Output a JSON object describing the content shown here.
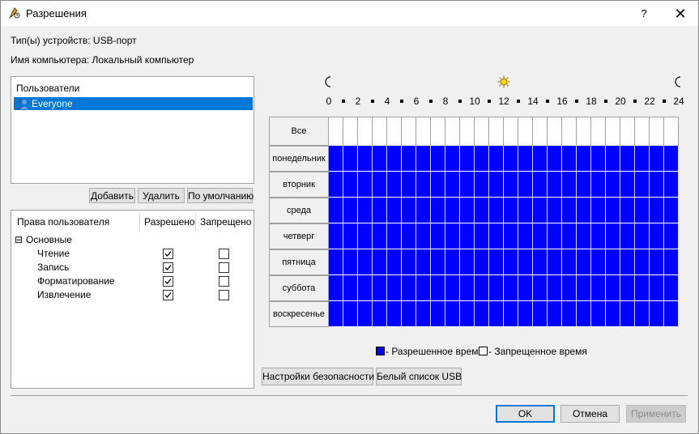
{
  "window": {
    "title": "Разрешения",
    "help_label": "?",
    "close_label": "✕"
  },
  "info": {
    "device_types": "Тип(ы) устройств: USB-порт",
    "computer_name": "Имя компьютера: Локальный компьютер"
  },
  "users": {
    "header": "Пользователи",
    "items": [
      {
        "name": "Everyone",
        "selected": true,
        "icon": "users-group-icon"
      }
    ],
    "add_button": "Добавить",
    "remove_button": "Удалить",
    "default_button": "По умолчанию"
  },
  "permissions": {
    "col_rights": "Права пользователя",
    "col_allowed": "Разрешено",
    "col_denied": "Запрещено",
    "group_toggle": "⊟",
    "group": "Основные",
    "rows": [
      {
        "label": "Чтение",
        "allowed": true,
        "denied": false
      },
      {
        "label": "Запись",
        "allowed": true,
        "denied": false
      },
      {
        "label": "Форматирование",
        "allowed": true,
        "denied": false
      },
      {
        "label": "Извлечение",
        "allowed": true,
        "denied": false
      }
    ]
  },
  "schedule": {
    "hours": [
      "0",
      "2",
      "4",
      "6",
      "8",
      "10",
      "12",
      "14",
      "16",
      "18",
      "20",
      "22",
      "24"
    ],
    "icons": [
      "moon-icon",
      "sun-icon",
      "moon-icon"
    ],
    "all_label": "Все",
    "days": [
      "понедельник",
      "вторник",
      "среда",
      "четверг",
      "пятница",
      "суббота",
      "воскресенье"
    ],
    "allowed_color": "#0000ff",
    "legend_allowed": "- Разрешенное время",
    "legend_denied": "- Запрещенное время",
    "security_button": "Настройки безопасности",
    "whitelist_button": "Белый список USB"
  },
  "footer": {
    "ok": "OK",
    "cancel": "Отмена",
    "apply": "Применить"
  }
}
